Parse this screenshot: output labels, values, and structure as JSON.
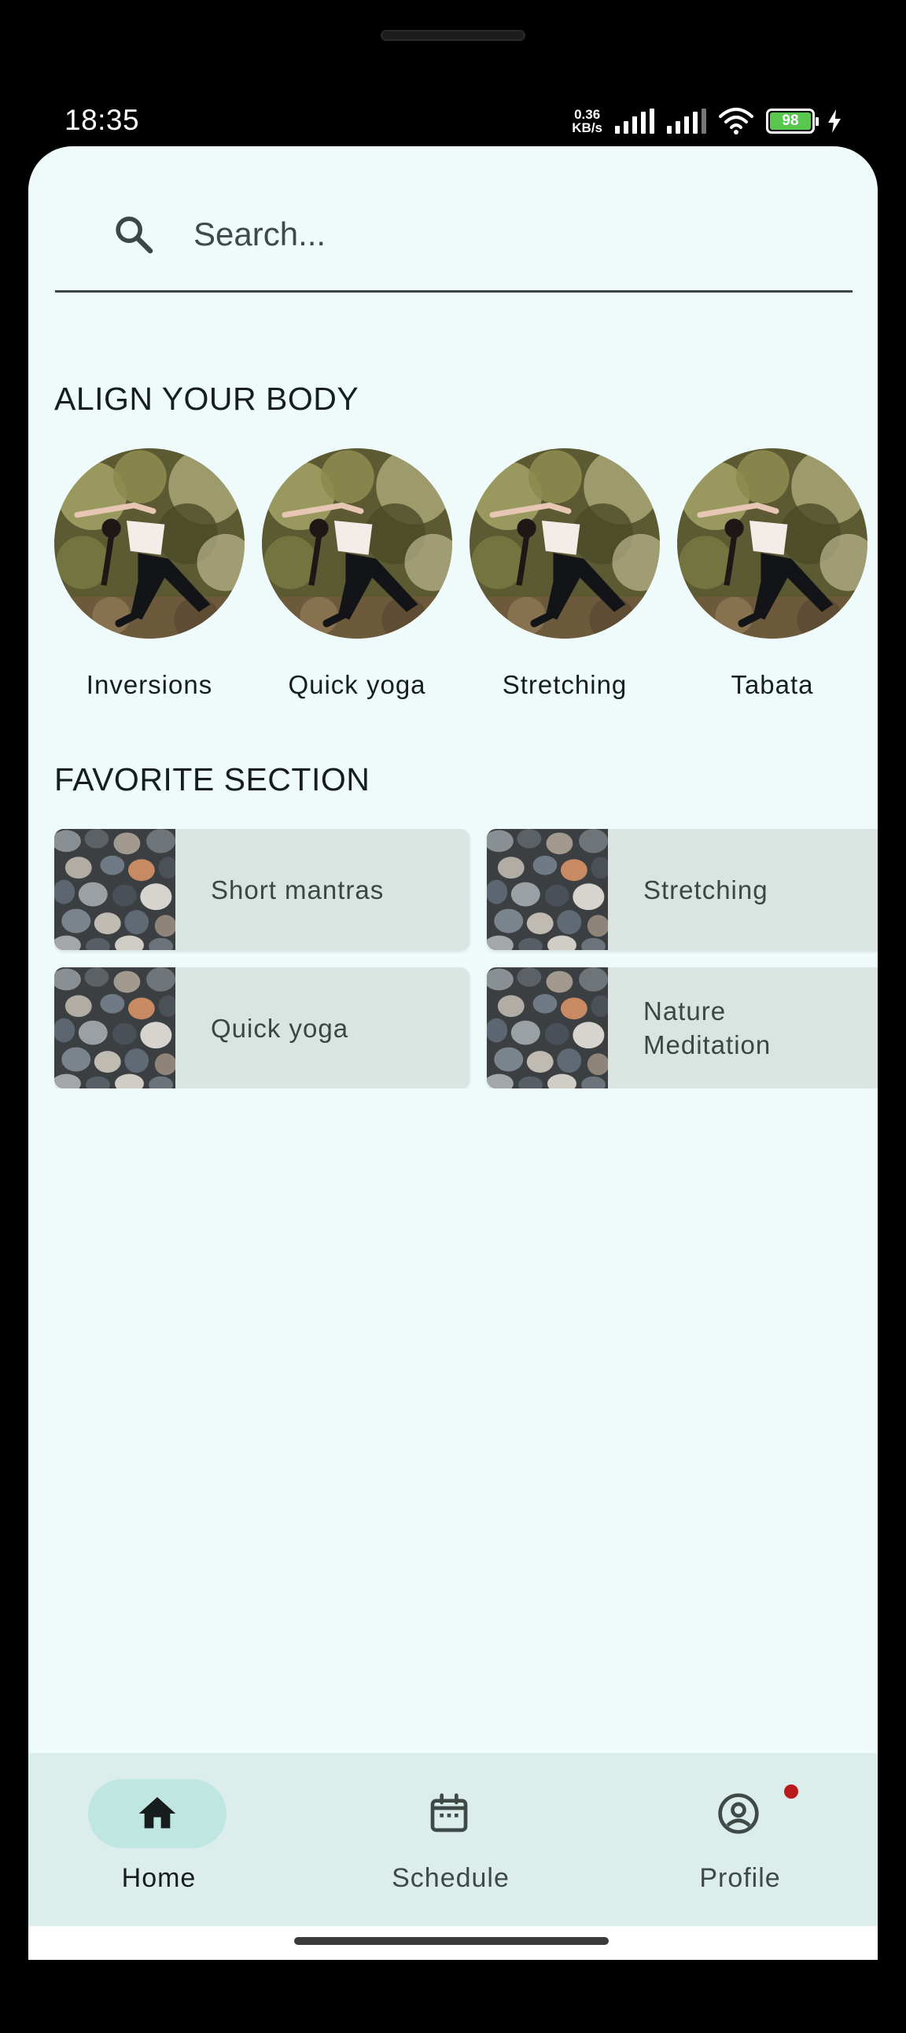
{
  "status_bar": {
    "time": "18:35",
    "net_speed_value": "0.36",
    "net_speed_unit": "KB/s",
    "battery_level": "98"
  },
  "search": {
    "placeholder": "Search..."
  },
  "align_section": {
    "title": "ALIGN YOUR BODY",
    "items": [
      {
        "label": "Inversions"
      },
      {
        "label": "Quick yoga"
      },
      {
        "label": "Stretching"
      },
      {
        "label": "Tabata"
      }
    ]
  },
  "favorite_section": {
    "title": "FAVORITE SECTION",
    "items": [
      {
        "label": "Short mantras"
      },
      {
        "label": "Stretching"
      },
      {
        "label": "Quick yoga"
      },
      {
        "label": "Nature\nMeditation"
      }
    ]
  },
  "bottom_nav": {
    "items": [
      {
        "label": "Home",
        "icon": "home-icon",
        "active": true
      },
      {
        "label": "Schedule",
        "icon": "calendar-icon",
        "active": false
      },
      {
        "label": "Profile",
        "icon": "account-circle-icon",
        "active": false,
        "badge": true
      }
    ]
  },
  "colors": {
    "background": "#effbfa",
    "nav_background": "#dceeec",
    "active_pill": "#bfe6e1",
    "card_background": "#dae4e1",
    "badge": "#ba1a1a"
  }
}
